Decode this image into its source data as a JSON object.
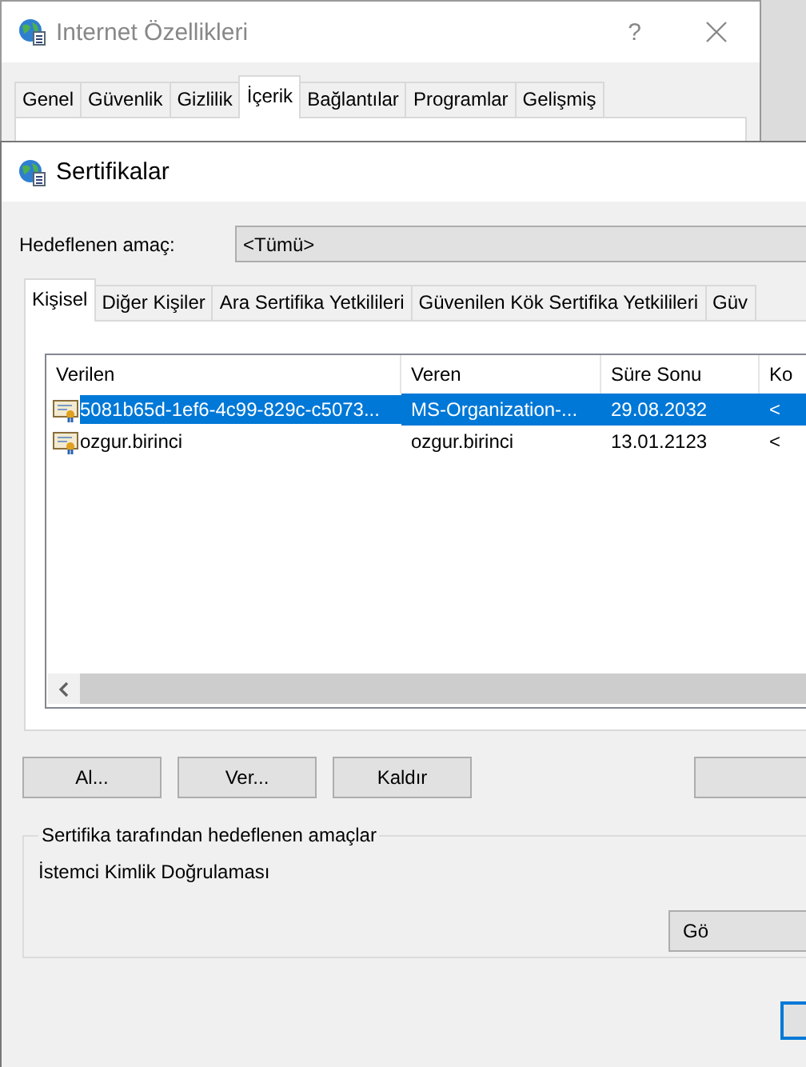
{
  "background_window": {
    "title": "Internet Özellikleri",
    "help_button": "?",
    "tabs": [
      {
        "label": "Genel",
        "selected": false
      },
      {
        "label": "Güvenlik",
        "selected": false
      },
      {
        "label": "Gizlilik",
        "selected": false
      },
      {
        "label": "İçerik",
        "selected": true
      },
      {
        "label": "Bağlantılar",
        "selected": false
      },
      {
        "label": "Programlar",
        "selected": false
      },
      {
        "label": "Gelişmiş",
        "selected": false
      }
    ]
  },
  "dialog": {
    "title": "Sertifikalar",
    "purpose_label": "Hedeflenen amaç:",
    "purpose_value": "<Tümü>",
    "tabs": [
      {
        "label": "Kişisel",
        "selected": true
      },
      {
        "label": "Diğer Kişiler",
        "selected": false
      },
      {
        "label": "Ara Sertifika Yetkilileri",
        "selected": false
      },
      {
        "label": "Güvenilen Kök Sertifika Yetkilileri",
        "selected": false
      },
      {
        "label": "Güv",
        "selected": false
      }
    ],
    "table": {
      "columns": [
        "Verilen",
        "Veren",
        "Süre Sonu",
        "Ko"
      ],
      "rows": [
        {
          "cells": [
            "5081b65d-1ef6-4c99-829c-c5073...",
            "MS-Organization-...",
            "29.08.2032",
            "<"
          ],
          "selected": true
        },
        {
          "cells": [
            "ozgur.birinci",
            "ozgur.birinci",
            "13.01.2123",
            "<"
          ],
          "selected": false
        }
      ]
    },
    "buttons": [
      "Al...",
      "Ver...",
      "Kaldır"
    ],
    "purposes_group": {
      "legend": "Sertifika tarafından hedeflenen amaçlar",
      "text": "İstemci Kimlik Doğrulaması",
      "button": "Gö"
    }
  }
}
